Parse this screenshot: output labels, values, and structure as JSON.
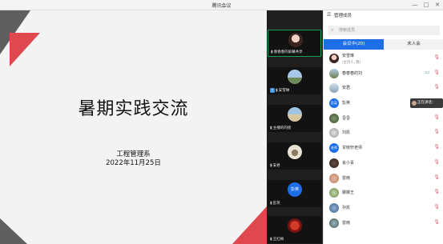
{
  "window": {
    "title": "腾讯会议",
    "controls": [
      "—",
      "□",
      "✕"
    ]
  },
  "slide": {
    "title": "暑期实践交流",
    "line1": "工程管理系",
    "line2": "2022年11月25日",
    "colors": {
      "red": "#e0484f",
      "gray": "#5f5f5f"
    }
  },
  "video_tiles": [
    {
      "name": "春春春的屏幕共享",
      "avatar": "photo",
      "active": true,
      "tag": ""
    },
    {
      "name": "安雪琳",
      "avatar": "photo",
      "active": false,
      "tag": "主"
    },
    {
      "name": "主播的的接",
      "avatar": "photo",
      "active": false,
      "tag": ""
    },
    {
      "name": "安君",
      "avatar": "photo",
      "active": false,
      "tag": ""
    },
    {
      "name": "彭英",
      "avatar": "text",
      "avatar_text": "彭英",
      "active": false,
      "tag": ""
    },
    {
      "name": "王红梅",
      "avatar": "photo",
      "active": false,
      "tag": ""
    }
  ],
  "panel": {
    "title": "管理成员",
    "search_placeholder": "搜索成员",
    "tabs": [
      {
        "label": "会议中(20)",
        "active": true
      },
      {
        "label": "未入会",
        "active": false
      }
    ],
    "members": [
      {
        "name": "安雪琳",
        "sub": "(主持人, 我)",
        "avatar": "photo"
      },
      {
        "name": "春春春的刘",
        "sub": "",
        "avatar": "photo",
        "cam": true
      },
      {
        "name": "安君",
        "sub": "",
        "avatar": "photo"
      },
      {
        "name": "彭英",
        "sub": "",
        "avatar": "text",
        "avatar_text": "彭英"
      },
      {
        "name": "昏昏",
        "sub": "",
        "avatar": "photo"
      },
      {
        "name": "刘凯",
        "sub": "",
        "avatar": "photo"
      },
      {
        "name": "甘晓轩老师",
        "sub": "",
        "avatar": "text",
        "avatar_text": "老师"
      },
      {
        "name": "肖小青",
        "sub": "",
        "avatar": "photo"
      },
      {
        "name": "雷雨",
        "sub": "",
        "avatar": "photo"
      },
      {
        "name": "娜娜王",
        "sub": "",
        "avatar": "photo"
      },
      {
        "name": "孙凯",
        "sub": "",
        "avatar": "photo"
      },
      {
        "name": "雷雨",
        "sub": "",
        "avatar": "photo"
      }
    ],
    "speaking": "正在讲话："
  },
  "colors": {
    "accent": "#1e6ee8",
    "green": "#1a9a55",
    "mic_muted": "#e05a6a"
  }
}
